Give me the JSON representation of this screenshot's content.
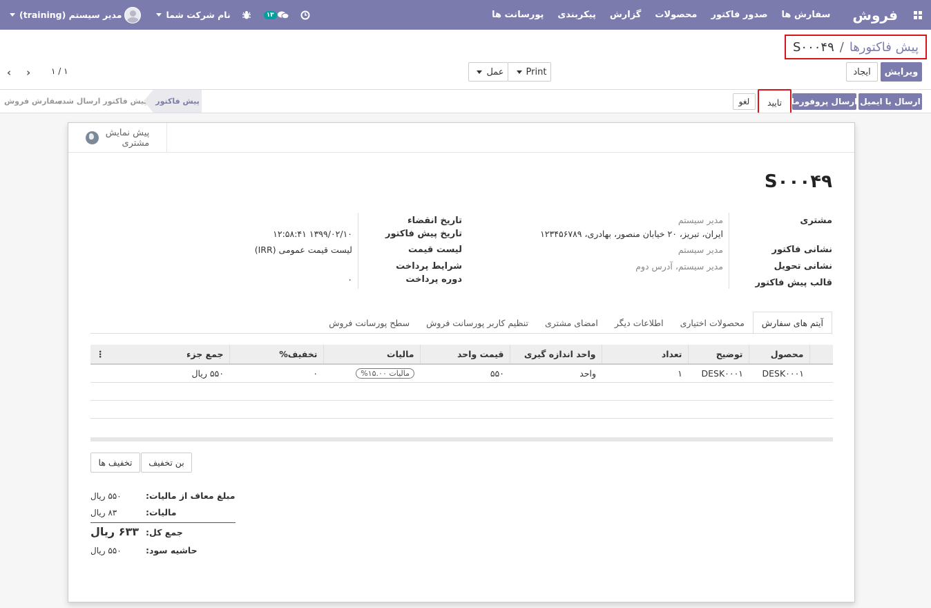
{
  "navbar": {
    "brand": "فروش",
    "menu": [
      "سفارش ها",
      "صدور فاکتور",
      "محصولات",
      "گزارش",
      "پیکربندی",
      "پورسانت ها"
    ],
    "chat_count": "۱۳",
    "company": "نام شرکت شما",
    "user": "مدیر سیستم (training)"
  },
  "breadcrumb": {
    "parent": "پیش فاکتورها",
    "separator": "/",
    "current": "S۰۰۰۴۹"
  },
  "buttons": {
    "edit": "ویرایش",
    "create": "ایجاد",
    "print": "Print",
    "action": "عمل",
    "send_email": "ارسال با ایمیل",
    "send_proforma": "ارسال پروفورما",
    "confirm": "تایید",
    "cancel": "لغو",
    "discounts": "تخفیف ها",
    "coupon": "بن تخفیف"
  },
  "pager": {
    "text": "۱ / ۱"
  },
  "stages": {
    "quotation": "پیش فاکتور",
    "sent": "پیش فاکتور ارسال شده",
    "sale": "سفارش فروش"
  },
  "smart_button": {
    "line1": "پیش نمایش",
    "line2": "مشتری"
  },
  "order": {
    "name": "S۰۰۰۴۹",
    "labels": {
      "customer": "مشتری",
      "invoice_address": "نشانی فاکتور",
      "delivery_address": "نشانی تحویل",
      "quote_template": "قالب پیش فاکتور",
      "expiration": "تاریخ انقضاء",
      "quote_date": "تاریخ پیش فاکتور",
      "pricelist": "لیست قیمت",
      "payment_terms": "شرایط پرداخت",
      "payment_period": "دوره پرداخت"
    },
    "customer": "مدیر سیستم",
    "customer_address": "ایران، تبریز، ۲۰ خیابان منصور، بهادری، ۱۲۳۴۵۶۷۸۹",
    "invoice_address": "مدیر سیستم",
    "delivery_address": "مدیر سیستم، آدرس دوم",
    "quote_date": "۱۳۹۹/۰۲/۱۰ ۱۲:۵۸:۴۱",
    "pricelist": "لیست قیمت عمومی (IRR)",
    "payment_period": "۰"
  },
  "tabs": [
    "آیتم های سفارش",
    "محصولات اختیاری",
    "اطلاعات دیگر",
    "امضای مشتری",
    "تنظیم کاربر پورسانت فروش",
    "سطح پورسانت فروش"
  ],
  "table": {
    "headers": [
      "محصول",
      "توضیح",
      "تعداد",
      "واحد اندازه گیری",
      "قیمت واحد",
      "مالیات",
      "تخفیف%",
      "جمع جزء"
    ],
    "rows": [
      [
        "DESK۰۰۰۱",
        "DESK۰۰۰۱",
        "۱",
        "واحد",
        "۵۵۰",
        "مالیات ۱۵.۰۰%",
        "۰",
        "۵۵۰ ریال"
      ]
    ]
  },
  "totals": {
    "untaxed_label": "مبلغ معاف از مالیات:",
    "untaxed": "۵۵۰ ریال",
    "tax_label": "مالیات:",
    "tax": "۸۳ ریال",
    "total_label": "جمع کل:",
    "total": "۶۳۳ ریال",
    "margin_label": "حاشیه سود:",
    "margin": "۵۵۰ ریال"
  },
  "colors": {
    "brand": "#7c7bad",
    "highlight_border": "#d4151b"
  }
}
